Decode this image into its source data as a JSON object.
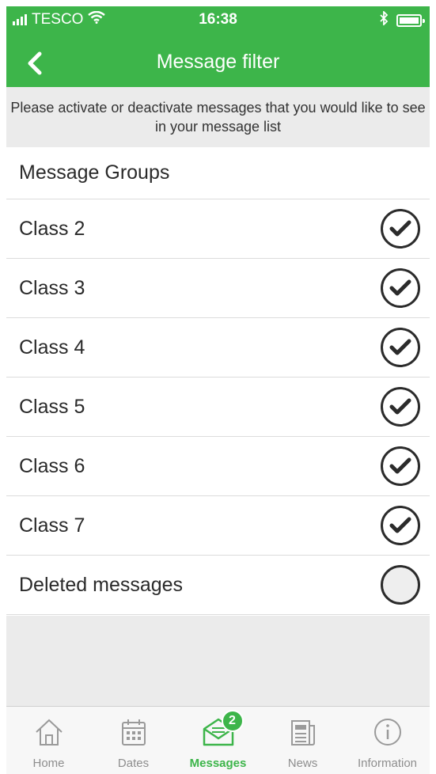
{
  "status_bar": {
    "carrier": "TESCO",
    "time": "16:38"
  },
  "header": {
    "title": "Message filter",
    "back_icon": "chevron-left-icon"
  },
  "info_text": "Please activate or deactivate messages that you would like to see in your message list",
  "list": {
    "group_header": "Message Groups",
    "items": [
      {
        "label": "Class 2",
        "checked": true
      },
      {
        "label": "Class 3",
        "checked": true
      },
      {
        "label": "Class 4",
        "checked": true
      },
      {
        "label": "Class 5",
        "checked": true
      },
      {
        "label": "Class 6",
        "checked": true
      },
      {
        "label": "Class 7",
        "checked": true
      },
      {
        "label": "Deleted messages",
        "checked": false
      }
    ]
  },
  "tabbar": {
    "tabs": [
      {
        "label": "Home",
        "icon": "home-icon",
        "active": false
      },
      {
        "label": "Dates",
        "icon": "calendar-icon",
        "active": false
      },
      {
        "label": "Messages",
        "icon": "envelope-icon",
        "active": true,
        "badge": "2"
      },
      {
        "label": "News",
        "icon": "newspaper-icon",
        "active": false
      },
      {
        "label": "Information",
        "icon": "info-icon",
        "active": false
      }
    ]
  },
  "colors": {
    "brand_green": "#3db54a",
    "background_gray": "#ebebeb",
    "text_dark": "#2a2a2a"
  }
}
